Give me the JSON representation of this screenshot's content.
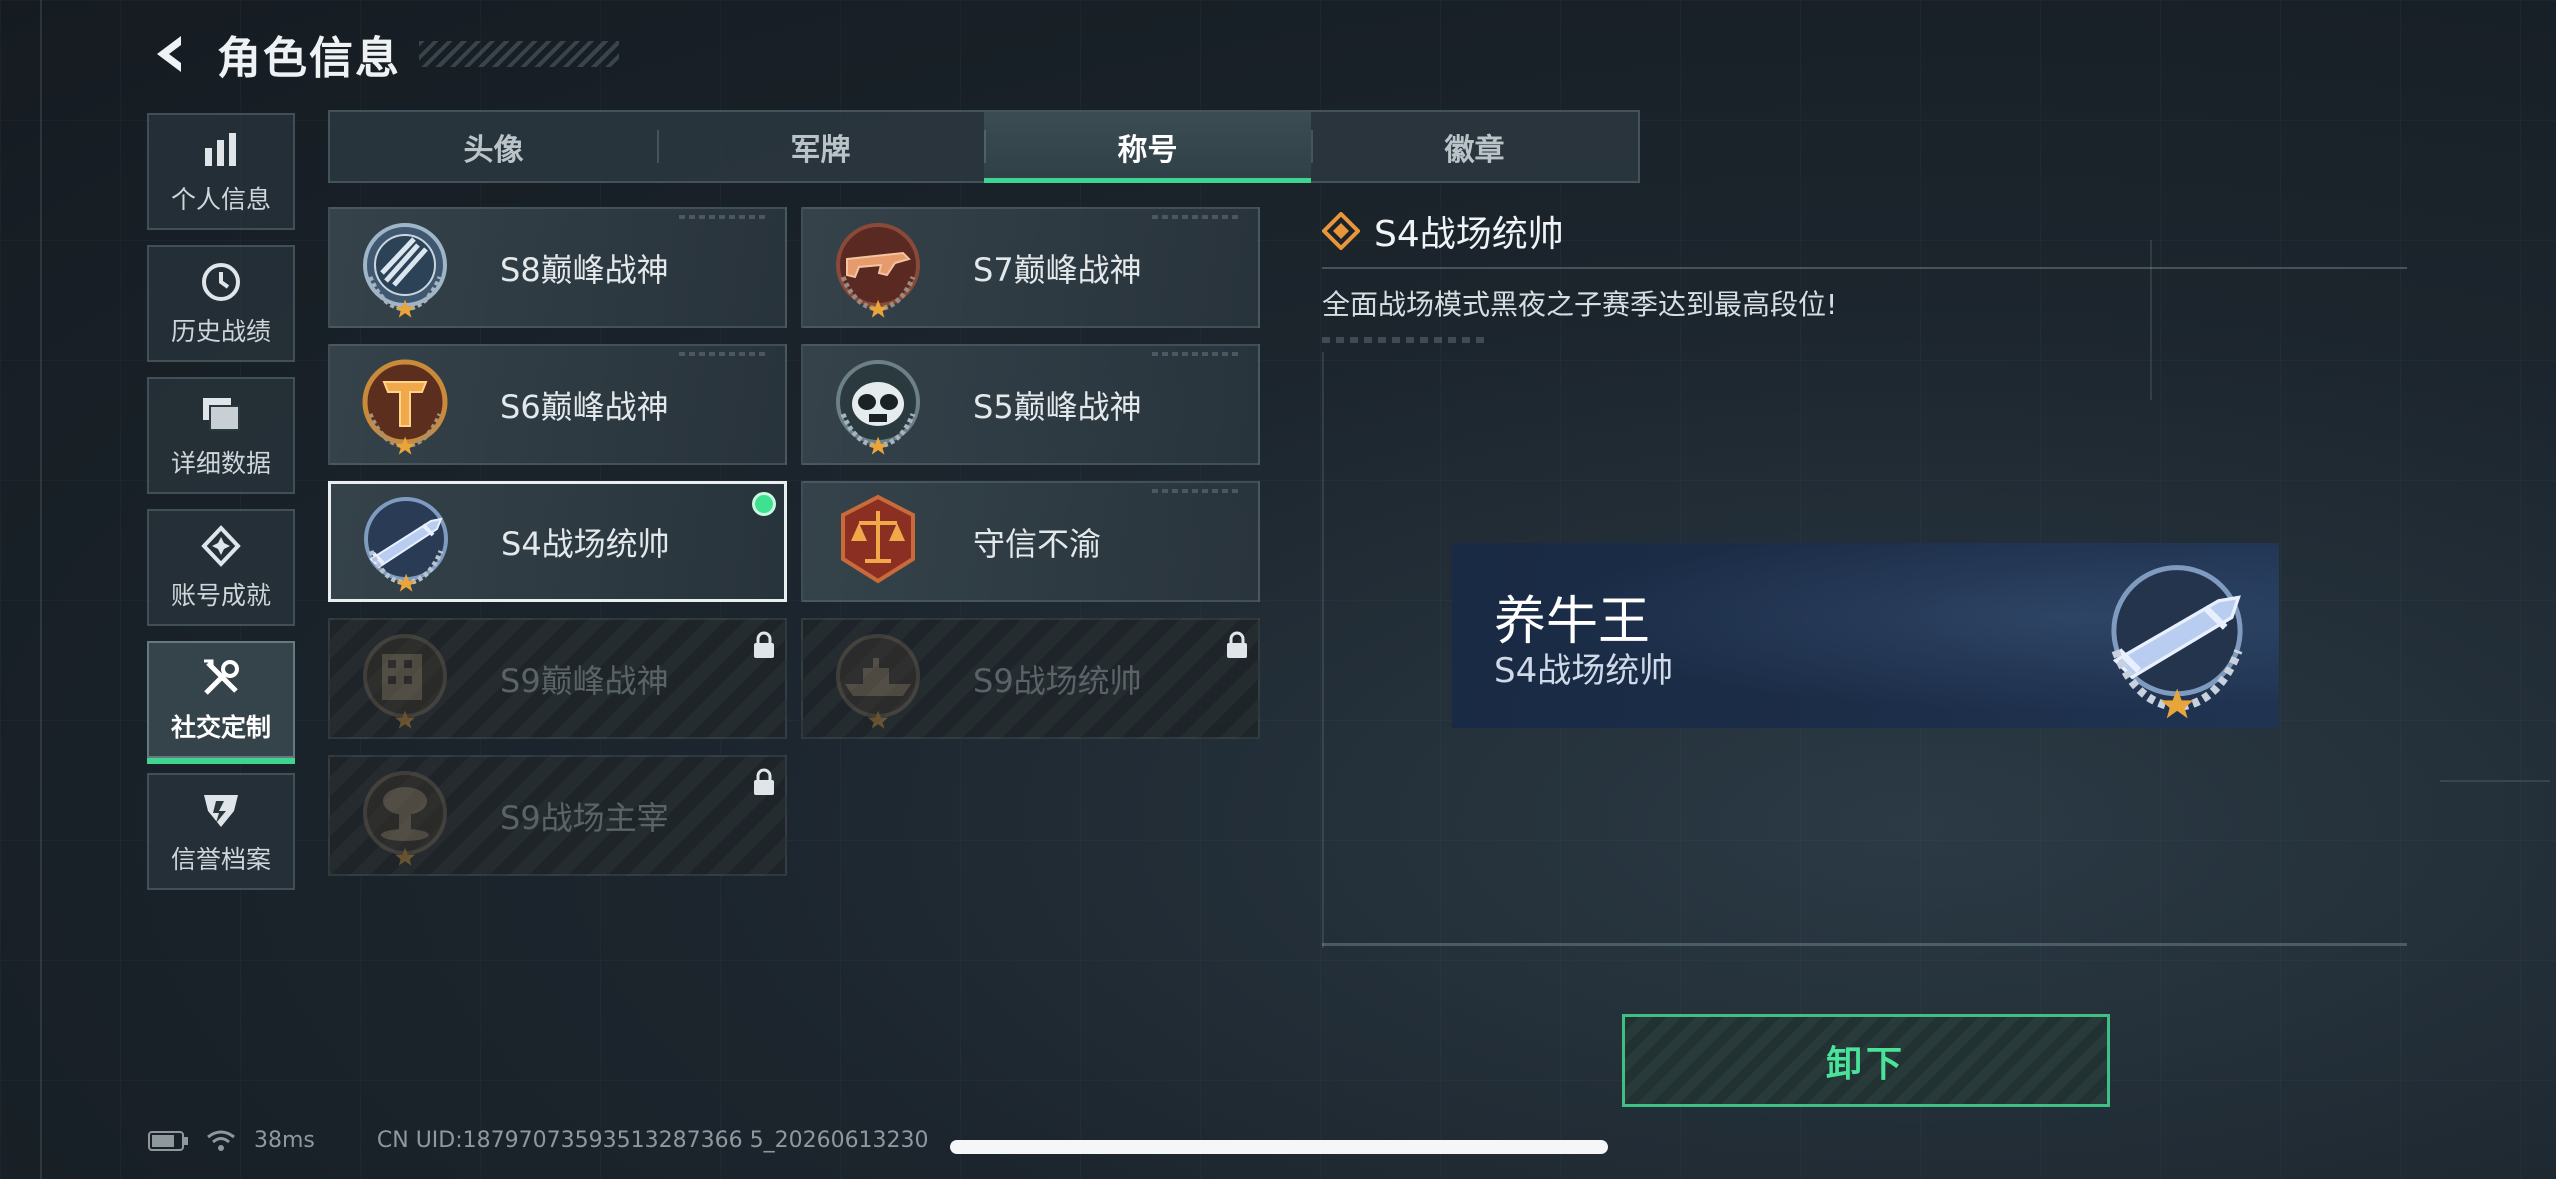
{
  "header": {
    "title": "角色信息"
  },
  "sidebar": {
    "items": [
      {
        "label": "个人信息",
        "icon": "bar-chart-icon"
      },
      {
        "label": "历史战绩",
        "icon": "clock-icon"
      },
      {
        "label": "详细数据",
        "icon": "folders-icon"
      },
      {
        "label": "账号成就",
        "icon": "achievement-icon"
      },
      {
        "label": "社交定制",
        "icon": "tools-icon",
        "active": true
      },
      {
        "label": "信誉档案",
        "icon": "credit-badge-icon"
      }
    ]
  },
  "tabs": [
    {
      "label": "头像"
    },
    {
      "label": "军牌"
    },
    {
      "label": "称号",
      "active": true
    },
    {
      "label": "徽章"
    }
  ],
  "titles": [
    {
      "name": "S8巅峰战神",
      "medal": "crossed-rifles-medal",
      "locked": false
    },
    {
      "name": "S7巅峰战神",
      "medal": "assault-rifle-medal",
      "locked": false
    },
    {
      "name": "S6巅峰战神",
      "medal": "t-emblem-medal",
      "locked": false
    },
    {
      "name": "S5巅峰战神",
      "medal": "skull-mask-medal",
      "locked": false
    },
    {
      "name": "S4战场统帅",
      "medal": "missile-medal",
      "locked": false,
      "selected": true,
      "equipped": true
    },
    {
      "name": "守信不渝",
      "medal": "scales-medal",
      "locked": false
    },
    {
      "name": "S9巅峰战神",
      "medal": "building-medal",
      "locked": true
    },
    {
      "name": "S9战场统帅",
      "medal": "warship-medal",
      "locked": true
    },
    {
      "name": "S9战场主宰",
      "medal": "mushroom-cloud-medal",
      "locked": true
    }
  ],
  "detail": {
    "title": "S4战场统帅",
    "description": "全面战场模式黑夜之子赛季达到最高段位!"
  },
  "preview": {
    "player_name": "养牛王",
    "title": "S4战场统帅"
  },
  "actions": {
    "unequip_label": "卸下"
  },
  "status": {
    "ping": "38ms",
    "uid": "CN UID:18797073593513287366 5_20260613230"
  },
  "colors": {
    "accent": "#3fd48f",
    "accent_text": "#49e39a"
  }
}
